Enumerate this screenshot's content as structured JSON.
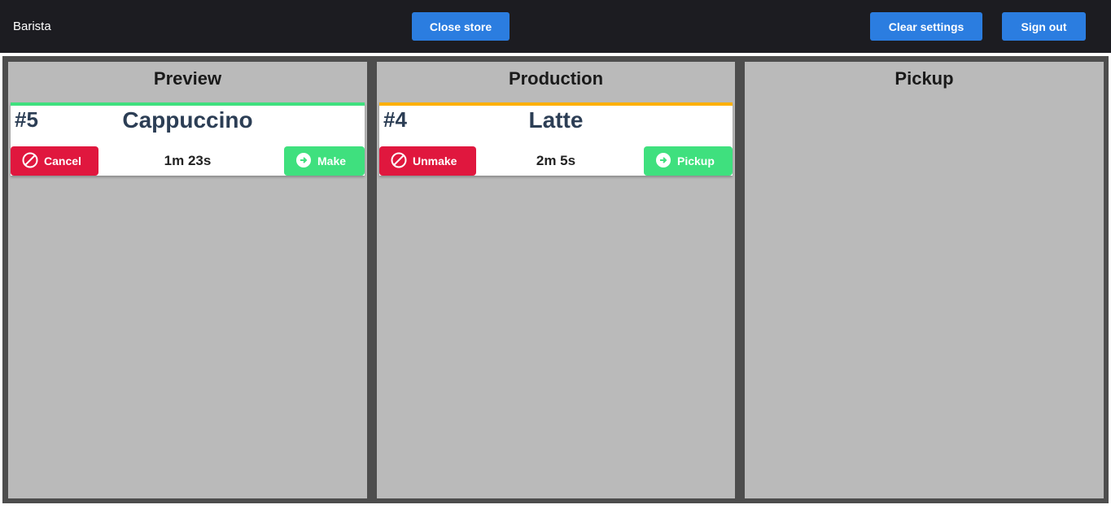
{
  "header": {
    "brand": "Barista",
    "close_store_label": "Close store",
    "clear_settings_label": "Clear settings",
    "sign_out_label": "Sign out"
  },
  "colors": {
    "header_bg": "#1c1c21",
    "primary_button": "#2b7de0",
    "cancel_red": "#e0173e",
    "advance_green": "#3fe07e",
    "preview_accent": "#3fe07e",
    "production_accent": "#ffb000"
  },
  "columns": [
    {
      "title": "Preview",
      "card": {
        "number": "#5",
        "drink": "Cappuccino",
        "timer": "1m 23s",
        "left_action": "Cancel",
        "right_action": "Make"
      }
    },
    {
      "title": "Production",
      "card": {
        "number": "#4",
        "drink": "Latte",
        "timer": "2m 5s",
        "left_action": "Unmake",
        "right_action": "Pickup"
      }
    },
    {
      "title": "Pickup"
    }
  ]
}
